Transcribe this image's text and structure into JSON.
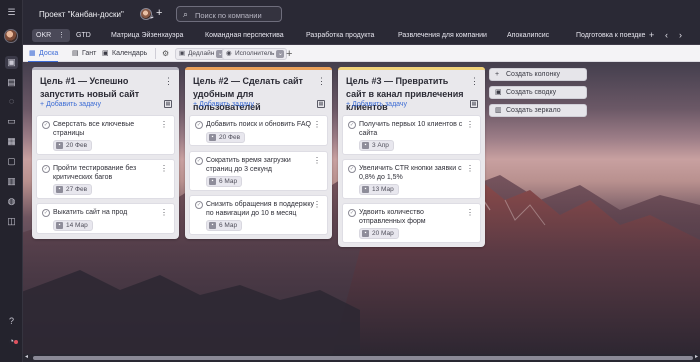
{
  "header": {
    "project_title": "Проект \"Канбан-доски\"",
    "search_placeholder": "Поиск по компании"
  },
  "tabs": [
    {
      "label": "OKR",
      "active": true
    },
    {
      "label": "GTD"
    },
    {
      "label": "Матрица Эйзенхауэра"
    },
    {
      "label": "Командная перспектива"
    },
    {
      "label": "Разработка продукта"
    },
    {
      "label": "Развлечения для компании"
    },
    {
      "label": "Апокалипсис"
    },
    {
      "label": "Подготовка к поездке"
    }
  ],
  "views": {
    "board": "Доска",
    "gantt": "Гант",
    "calendar": "Календарь"
  },
  "filters": {
    "deadline": "Дедлайн",
    "assignee": "Исполнитель"
  },
  "columns": [
    {
      "title": "Цель #1 — Успешно запустить новый сайт",
      "accent": "#b6b4c0",
      "add_task": "Добавить задачу",
      "cards": [
        {
          "text": "Сверстать все ключевые страницы",
          "date": "20 Фев"
        },
        {
          "text": "Пройти тестирование без критических багов",
          "date": "27 Фев"
        },
        {
          "text": "Выкатить сайт на прод",
          "date": "14 Мар"
        }
      ]
    },
    {
      "title": "Цель #2 — Сделать сайт удобным для пользователей",
      "accent": "#e9a05a",
      "add_task": "Добавить задачу",
      "cards": [
        {
          "text": "Добавить поиск и обновить FAQ",
          "date": "20 Фев"
        },
        {
          "text": "Сократить время загрузки страниц до 3 секунд",
          "date": "6 Мар"
        },
        {
          "text": "Снизить обращения в поддержку по навигации до 10 в месяц",
          "date": "6 Мар"
        }
      ]
    },
    {
      "title": "Цель #3 — Превратить сайт в канал привлечения клиентов",
      "accent": "#f0d27a",
      "add_task": "Добавить задачу",
      "cards": [
        {
          "text": "Получить первых 10 клиентов с сайта",
          "date": "3 Апр"
        },
        {
          "text": "Увеличить CTR кнопки заявки с 0,8% до 1,5%",
          "date": "13 Мар"
        },
        {
          "text": "Удвоить количество отправленных форм",
          "date": "20 Мар"
        }
      ]
    }
  ],
  "actions": {
    "create_column": "Создать колонку",
    "create_summary": "Создать сводку",
    "create_mirror": "Создать зеркало"
  }
}
